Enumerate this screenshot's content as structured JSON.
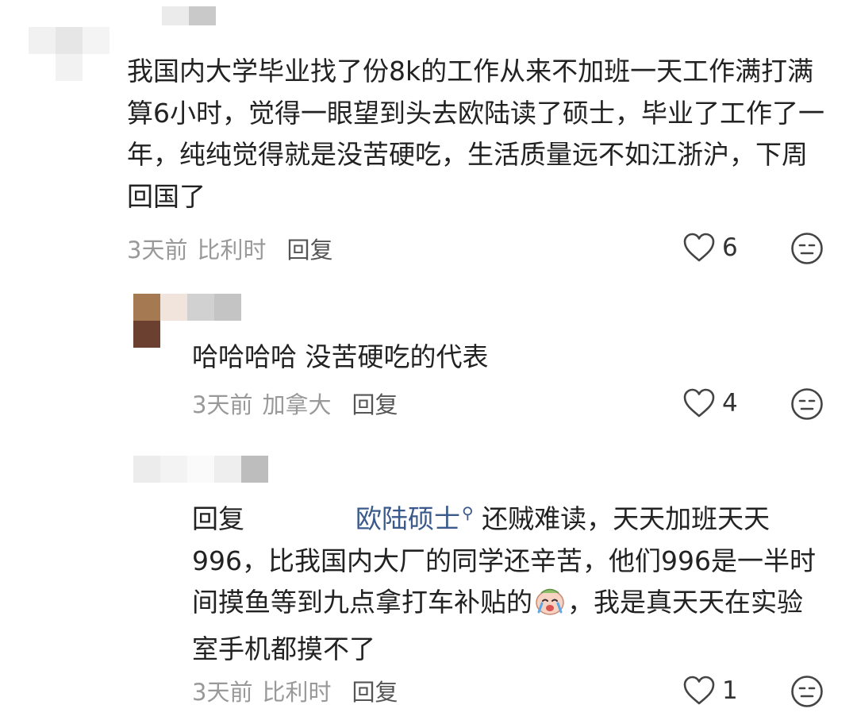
{
  "comments": [
    {
      "text": "我国内大学毕业找了份8k的工作从来不加班一天工作满打满算6小时，觉得一眼望到头去欧陆读了硕士，毕业了工作了一年，纯纯觉得就是没苦硬吃，生活质量远不如江浙沪，下周回国了",
      "time": "3天前",
      "location": "比利时",
      "reply_label": "回复",
      "likes": "6"
    },
    {
      "text": "哈哈哈哈 没苦硬吃的代表",
      "time": "3天前",
      "location": "加拿大",
      "reply_label": "回复",
      "likes": "4"
    },
    {
      "reply_prefix": "回复",
      "mention": "欧陆硕士",
      "text_part1": "还贼难读，天天加班天天996，比我国内大厂的同学还辛苦，他们996是一半时间摸鱼等到九点拿打车补贴的",
      "text_part2": "，我是真天天在实验室手机都摸不了",
      "time": "3天前",
      "location": "比利时",
      "reply_label": "回复",
      "likes": "1"
    }
  ],
  "icons": {
    "like": "heart-outline-icon",
    "emoji": "neutral-face-icon",
    "inline_emoji": "crying-face-emoji",
    "mention_search": "search-icon"
  },
  "colors": {
    "text": "#222222",
    "meta": "#999999",
    "mention": "#3a5a8c"
  }
}
